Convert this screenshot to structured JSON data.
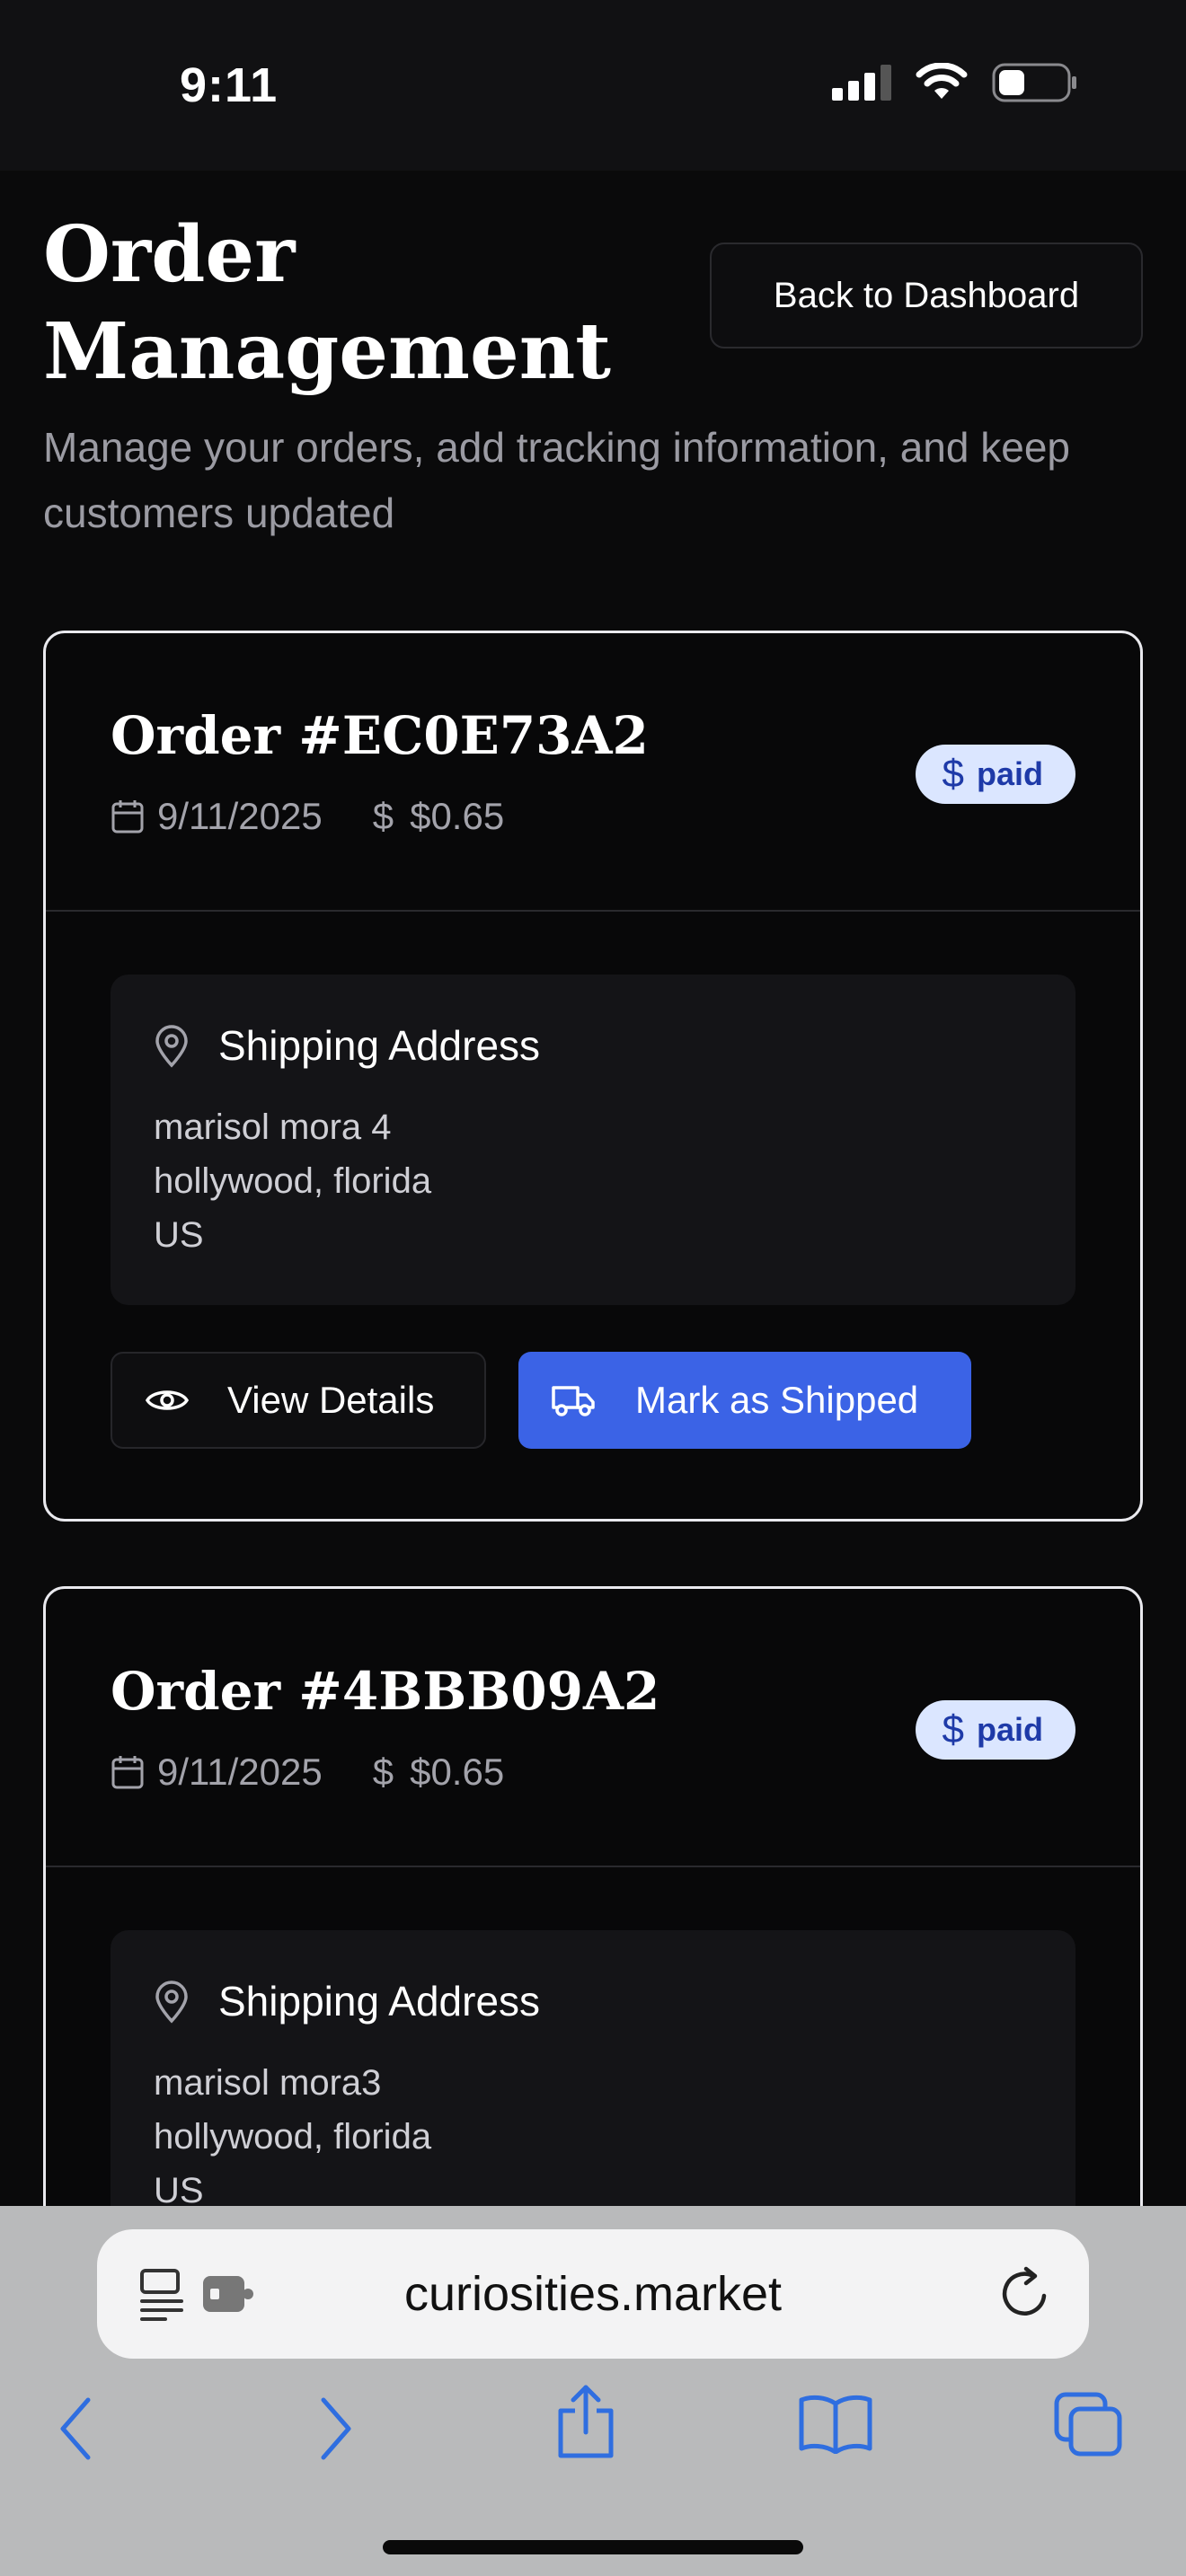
{
  "status": {
    "time": "9:11"
  },
  "header": {
    "title": "Order Management",
    "subtitle": "Manage your orders, add tracking information, and keep customers updated",
    "back_button": "Back to Dashboard"
  },
  "orders": [
    {
      "title": "Order #EC0E73A2",
      "date": "9/11/2025",
      "amount": "$0.65",
      "status": "paid",
      "address_title": "Shipping Address",
      "address_lines": [
        "marisol mora 4",
        "hollywood, florida",
        "US"
      ],
      "view_label": "View Details",
      "ship_label": "Mark as Shipped"
    },
    {
      "title": "Order #4BBB09A2",
      "date": "9/11/2025",
      "amount": "$0.65",
      "status": "paid",
      "address_title": "Shipping Address",
      "address_lines": [
        "marisol mora3",
        "hollywood, florida",
        "US"
      ]
    }
  ],
  "browser": {
    "url": "curiosities.market"
  },
  "colors": {
    "accent": "#3b63e6",
    "badge_bg": "#dbe6ff",
    "badge_text": "#1e3aa8",
    "safari_blue": "#2f6ee0"
  }
}
